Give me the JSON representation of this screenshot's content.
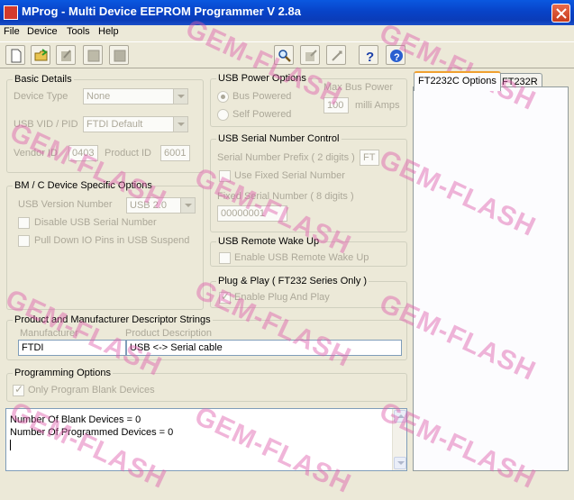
{
  "window": {
    "title": "MProg - Multi Device EEPROM Programmer V 2.8a"
  },
  "menu": {
    "items": [
      "File",
      "Device",
      "Tools",
      "Help"
    ]
  },
  "toolbar": {
    "left_buttons": [
      "new-file-icon",
      "open-folder-icon",
      "edit-icon",
      "save-icon",
      "erase-icon"
    ],
    "right_buttons": [
      "search-icon",
      "program-icon",
      "flash-icon",
      "help-icon",
      "info-icon"
    ]
  },
  "basic_details": {
    "title": "Basic Details",
    "device_type_label": "Device Type",
    "device_type_value": "None",
    "usb_vid_pid_label": "USB VID / PID",
    "usb_vid_pid_value": "FTDI Default",
    "vendor_id_label": "Vendor ID",
    "vendor_id_value": "0403",
    "product_id_label": "Product ID",
    "product_id_value": "6001"
  },
  "bm_c": {
    "title": "BM / C Device Specific Options",
    "usb_version_label": "USB Version Number",
    "usb_version_value": "USB 2.0",
    "disable_serial_label": "Disable USB Serial Number",
    "pull_down_label": "Pull Down IO Pins in USB Suspend"
  },
  "usb_power": {
    "title": "USB Power Options",
    "bus_powered": "Bus Powered",
    "self_powered": "Self Powered",
    "max_bus_power_label": "Max Bus Power",
    "max_bus_power_value": "100",
    "milli_amps": "milli Amps"
  },
  "serial_control": {
    "title": "USB Serial Number Control",
    "prefix_label": "Serial Number Prefix ( 2 digits )",
    "prefix_value": "FT",
    "use_fixed_label": "Use Fixed Serial Number",
    "fixed_label": "Fixed Serial Number ( 8 digits )",
    "fixed_value": "00000001"
  },
  "remote_wake": {
    "title": "USB Remote Wake Up",
    "enable_label": "Enable USB Remote Wake Up"
  },
  "plug_play": {
    "title": "Plug & Play  ( FT232 Series Only )",
    "enable_label": "Enable Plug And Play"
  },
  "descriptor": {
    "title": "Product and Manufacturer Descriptor Strings",
    "manufacturer_label": "Manufacturer",
    "manufacturer_value": "FTDI",
    "product_desc_label": "Product Description",
    "product_desc_value": "USB <-> Serial cable"
  },
  "programming": {
    "title": "Programming Options",
    "only_blank_label": "Only Program Blank Devices"
  },
  "tabs": [
    "FT2232C Options",
    "FT232R"
  ],
  "log": {
    "lines": [
      "Number Of Blank Devices = 0",
      "Number Of Programmed Devices = 0"
    ]
  },
  "watermark": {
    "text": "GEM-FLASH"
  }
}
